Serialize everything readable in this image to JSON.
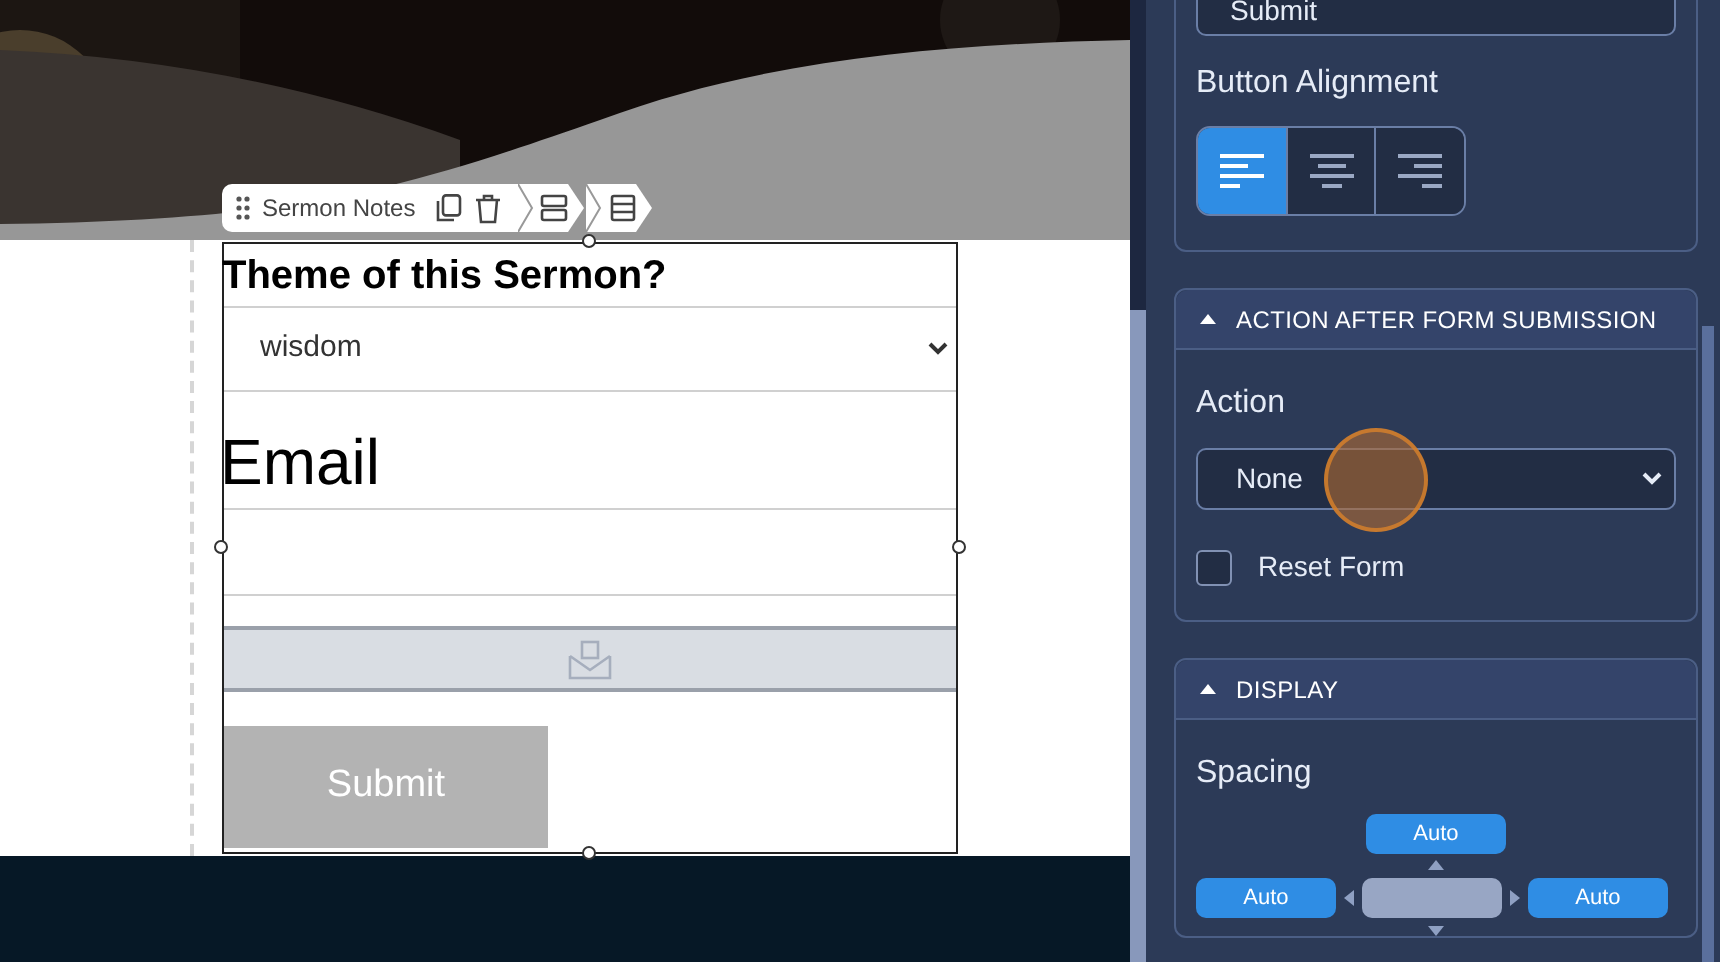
{
  "toolbar": {
    "label": "Sermon Notes"
  },
  "form": {
    "question": "Theme of this Sermon?",
    "select_value": "wisdom",
    "email_label": "Email",
    "submit_label": "Submit"
  },
  "panel": {
    "submit_field": "Submit",
    "alignment_label": "Button Alignment",
    "alignments": [
      {
        "kind": "left",
        "selected": true
      },
      {
        "kind": "center",
        "selected": false
      },
      {
        "kind": "right",
        "selected": false
      }
    ],
    "sections": [
      {
        "kind": "action",
        "title": "ACTION AFTER FORM SUBMISSION",
        "expanded": true,
        "action_label": "Action",
        "action_value": "None",
        "reset_label": "Reset Form",
        "reset_checked": false
      },
      {
        "kind": "display",
        "title": "DISPLAY",
        "expanded": true,
        "spacing_label": "Spacing",
        "spacing_top": "Auto",
        "spacing_left": "Auto",
        "spacing_right": "Auto"
      }
    ]
  }
}
